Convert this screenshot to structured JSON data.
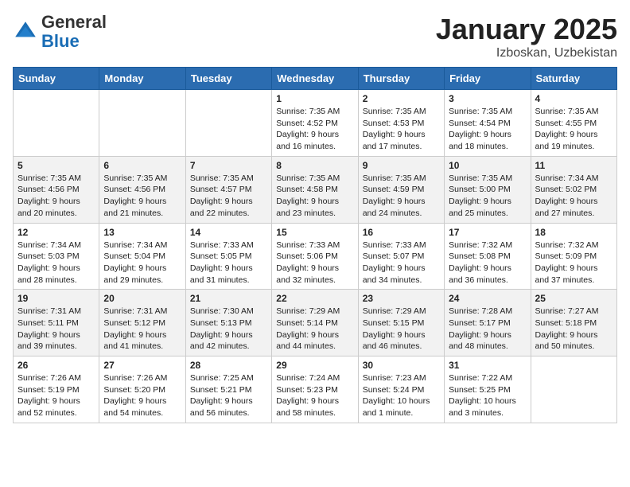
{
  "header": {
    "logo_general": "General",
    "logo_blue": "Blue",
    "month": "January 2025",
    "location": "Izboskan, Uzbekistan"
  },
  "weekdays": [
    "Sunday",
    "Monday",
    "Tuesday",
    "Wednesday",
    "Thursday",
    "Friday",
    "Saturday"
  ],
  "weeks": [
    [
      {
        "day": "",
        "info": ""
      },
      {
        "day": "",
        "info": ""
      },
      {
        "day": "",
        "info": ""
      },
      {
        "day": "1",
        "info": "Sunrise: 7:35 AM\nSunset: 4:52 PM\nDaylight: 9 hours\nand 16 minutes."
      },
      {
        "day": "2",
        "info": "Sunrise: 7:35 AM\nSunset: 4:53 PM\nDaylight: 9 hours\nand 17 minutes."
      },
      {
        "day": "3",
        "info": "Sunrise: 7:35 AM\nSunset: 4:54 PM\nDaylight: 9 hours\nand 18 minutes."
      },
      {
        "day": "4",
        "info": "Sunrise: 7:35 AM\nSunset: 4:55 PM\nDaylight: 9 hours\nand 19 minutes."
      }
    ],
    [
      {
        "day": "5",
        "info": "Sunrise: 7:35 AM\nSunset: 4:56 PM\nDaylight: 9 hours\nand 20 minutes."
      },
      {
        "day": "6",
        "info": "Sunrise: 7:35 AM\nSunset: 4:56 PM\nDaylight: 9 hours\nand 21 minutes."
      },
      {
        "day": "7",
        "info": "Sunrise: 7:35 AM\nSunset: 4:57 PM\nDaylight: 9 hours\nand 22 minutes."
      },
      {
        "day": "8",
        "info": "Sunrise: 7:35 AM\nSunset: 4:58 PM\nDaylight: 9 hours\nand 23 minutes."
      },
      {
        "day": "9",
        "info": "Sunrise: 7:35 AM\nSunset: 4:59 PM\nDaylight: 9 hours\nand 24 minutes."
      },
      {
        "day": "10",
        "info": "Sunrise: 7:35 AM\nSunset: 5:00 PM\nDaylight: 9 hours\nand 25 minutes."
      },
      {
        "day": "11",
        "info": "Sunrise: 7:34 AM\nSunset: 5:02 PM\nDaylight: 9 hours\nand 27 minutes."
      }
    ],
    [
      {
        "day": "12",
        "info": "Sunrise: 7:34 AM\nSunset: 5:03 PM\nDaylight: 9 hours\nand 28 minutes."
      },
      {
        "day": "13",
        "info": "Sunrise: 7:34 AM\nSunset: 5:04 PM\nDaylight: 9 hours\nand 29 minutes."
      },
      {
        "day": "14",
        "info": "Sunrise: 7:33 AM\nSunset: 5:05 PM\nDaylight: 9 hours\nand 31 minutes."
      },
      {
        "day": "15",
        "info": "Sunrise: 7:33 AM\nSunset: 5:06 PM\nDaylight: 9 hours\nand 32 minutes."
      },
      {
        "day": "16",
        "info": "Sunrise: 7:33 AM\nSunset: 5:07 PM\nDaylight: 9 hours\nand 34 minutes."
      },
      {
        "day": "17",
        "info": "Sunrise: 7:32 AM\nSunset: 5:08 PM\nDaylight: 9 hours\nand 36 minutes."
      },
      {
        "day": "18",
        "info": "Sunrise: 7:32 AM\nSunset: 5:09 PM\nDaylight: 9 hours\nand 37 minutes."
      }
    ],
    [
      {
        "day": "19",
        "info": "Sunrise: 7:31 AM\nSunset: 5:11 PM\nDaylight: 9 hours\nand 39 minutes."
      },
      {
        "day": "20",
        "info": "Sunrise: 7:31 AM\nSunset: 5:12 PM\nDaylight: 9 hours\nand 41 minutes."
      },
      {
        "day": "21",
        "info": "Sunrise: 7:30 AM\nSunset: 5:13 PM\nDaylight: 9 hours\nand 42 minutes."
      },
      {
        "day": "22",
        "info": "Sunrise: 7:29 AM\nSunset: 5:14 PM\nDaylight: 9 hours\nand 44 minutes."
      },
      {
        "day": "23",
        "info": "Sunrise: 7:29 AM\nSunset: 5:15 PM\nDaylight: 9 hours\nand 46 minutes."
      },
      {
        "day": "24",
        "info": "Sunrise: 7:28 AM\nSunset: 5:17 PM\nDaylight: 9 hours\nand 48 minutes."
      },
      {
        "day": "25",
        "info": "Sunrise: 7:27 AM\nSunset: 5:18 PM\nDaylight: 9 hours\nand 50 minutes."
      }
    ],
    [
      {
        "day": "26",
        "info": "Sunrise: 7:26 AM\nSunset: 5:19 PM\nDaylight: 9 hours\nand 52 minutes."
      },
      {
        "day": "27",
        "info": "Sunrise: 7:26 AM\nSunset: 5:20 PM\nDaylight: 9 hours\nand 54 minutes."
      },
      {
        "day": "28",
        "info": "Sunrise: 7:25 AM\nSunset: 5:21 PM\nDaylight: 9 hours\nand 56 minutes."
      },
      {
        "day": "29",
        "info": "Sunrise: 7:24 AM\nSunset: 5:23 PM\nDaylight: 9 hours\nand 58 minutes."
      },
      {
        "day": "30",
        "info": "Sunrise: 7:23 AM\nSunset: 5:24 PM\nDaylight: 10 hours\nand 1 minute."
      },
      {
        "day": "31",
        "info": "Sunrise: 7:22 AM\nSunset: 5:25 PM\nDaylight: 10 hours\nand 3 minutes."
      },
      {
        "day": "",
        "info": ""
      }
    ]
  ]
}
